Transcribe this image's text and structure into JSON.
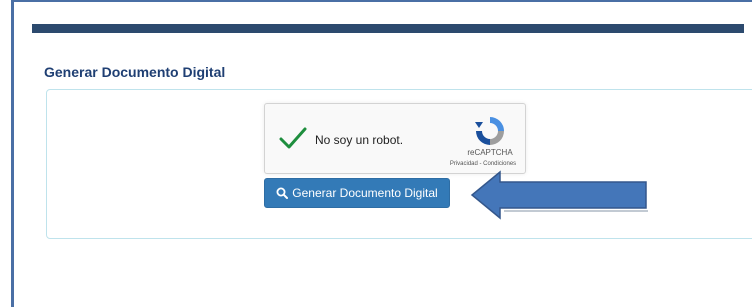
{
  "section": {
    "title": "Generar Documento Digital"
  },
  "captcha": {
    "label": "No soy un robot.",
    "brand": "reCAPTCHA",
    "links": "Privacidad - Condiciones",
    "checked": true,
    "icons": {
      "check": "checkmark-icon",
      "logo": "recaptcha-logo-icon"
    }
  },
  "submit": {
    "label": "Generar Documento Digital",
    "icon": "search-icon"
  },
  "colors": {
    "frame": "#4a6fa5",
    "top_bar": "#2c4a6e",
    "title": "#1f3f73",
    "panel_border": "#bfe3ec",
    "button": "#337ab7",
    "check": "#1e8e3e",
    "arrow": "#3b6fb6"
  }
}
